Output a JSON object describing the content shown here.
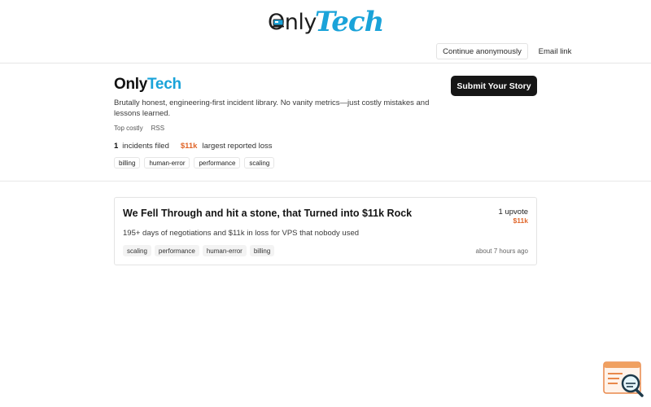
{
  "header": {
    "logo_only": "Only",
    "logo_tech": "Tech",
    "continue_anon": "Continue anonymously",
    "email_link": "Email link"
  },
  "profile": {
    "brand_only": "Only",
    "brand_tech": "Tech",
    "submit_label": "Submit Your Story",
    "description": "Brutally honest, engineering-first incident library. No vanity metrics—just costly mistakes and lessons learned.",
    "links": [
      "Top costly",
      "RSS"
    ],
    "incidents_count": "1",
    "incidents_label": "incidents filed",
    "largest_loss": "$11k",
    "largest_loss_label": "largest reported loss",
    "tags": [
      "billing",
      "human-error",
      "performance",
      "scaling"
    ]
  },
  "incident": {
    "title": "We Fell Through and hit a stone, that Turned into $11k Rock",
    "summary": "195+ days of negotiations and $11k in loss for VPS that nobody used",
    "tags": [
      "scaling",
      "performance",
      "human-error",
      "billing"
    ],
    "upvotes": "1 upvote",
    "loss": "$11k",
    "time": "about 7 hours ago"
  },
  "colors": {
    "accent_blue": "#1aa3d9",
    "accent_orange": "#e0662a",
    "button_dark": "#161616"
  },
  "icons": {
    "logo_laptop": "laptop-icon",
    "widget": "search-document-icon"
  }
}
